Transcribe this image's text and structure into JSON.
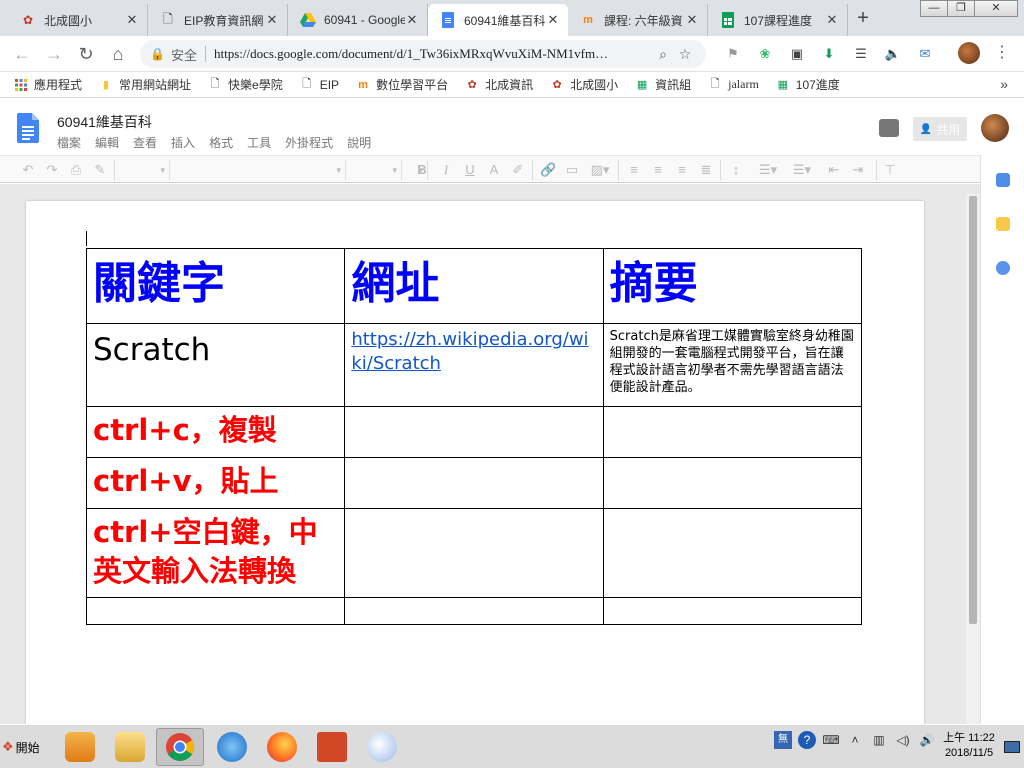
{
  "browser": {
    "tabs": [
      {
        "title": "北成國小",
        "icon": "beicheng-flower-icon",
        "icon_color": "#c0392b"
      },
      {
        "title": "EIP教育資訊網",
        "icon": "page-icon",
        "icon_color": "#666666"
      },
      {
        "title": "60941 - Google",
        "icon": "google-drive-icon",
        "icon_color": "#1fa463"
      },
      {
        "title": "60941維基百科",
        "icon": "google-docs-icon",
        "icon_color": "#4285f4"
      },
      {
        "title": "課程: 六年級資",
        "icon": "moodle-icon",
        "icon_color": "#f98012"
      },
      {
        "title": "107課程進度",
        "icon": "google-sheets-icon",
        "icon_color": "#0f9d58"
      }
    ],
    "active_tab_index": 3,
    "new_tab_label": "+",
    "window_controls": [
      "—",
      "❐",
      "✕"
    ],
    "address": {
      "secure_label": "安全",
      "url": "https://docs.google.com/document/d/1_Tw36ixMRxqWvuXiM-NM1vfm…"
    },
    "bookmarks": [
      {
        "label": "應用程式",
        "icon": "apps-grid-icon"
      },
      {
        "label": "常用網站網址",
        "icon": "folder-icon"
      },
      {
        "label": "快樂e學院",
        "icon": "page-icon"
      },
      {
        "label": "EIP",
        "icon": "page-icon"
      },
      {
        "label": "數位學習平台",
        "icon": "moodle-icon"
      },
      {
        "label": "北成資訊",
        "icon": "beicheng-flower-icon"
      },
      {
        "label": "北成國小",
        "icon": "beicheng-flower-icon"
      },
      {
        "label": "資訊組",
        "icon": "google-sheets-icon"
      },
      {
        "label": "jalarm",
        "icon": "page-icon"
      },
      {
        "label": "107進度",
        "icon": "google-sheets-icon"
      }
    ]
  },
  "docs": {
    "title": "60941維基百科",
    "menu": [
      "檔案",
      "編輯",
      "查看",
      "插入",
      "格式",
      "工具",
      "外掛程式",
      "說明"
    ],
    "share_label": "共用",
    "toolbar_icons": [
      "undo-icon",
      "redo-icon",
      "print-icon",
      "paint-format-icon",
      "zoom-select",
      "style-select",
      "font-select",
      "size-select",
      "bold-icon",
      "italic-icon",
      "underline-icon",
      "text-color-icon",
      "highlight-icon",
      "link-icon",
      "comment-icon",
      "image-icon",
      "align-left-icon",
      "align-center-icon",
      "align-right-icon",
      "justify-icon",
      "line-spacing-icon",
      "numbered-list-icon",
      "bulleted-list-icon",
      "decrease-indent-icon",
      "increase-indent-icon",
      "clear-format-icon"
    ]
  },
  "table": {
    "headers": [
      "關鍵字",
      "網址",
      "摘要"
    ],
    "rows": [
      {
        "keyword": "Scratch",
        "url": "https://zh.wikipedia.org/wiki/Scratch",
        "summary": "Scratch是麻省理工媒體實驗室終身幼稚園組開發的一套電腦程式開發平台，旨在讓程式設計語言初學者不需先學習語言語法便能設計產品。"
      },
      {
        "keyword": "ctrl+c，複製",
        "url": "",
        "summary": ""
      },
      {
        "keyword": "ctrl+v，貼上",
        "url": "",
        "summary": ""
      },
      {
        "keyword": "ctrl+空白鍵，中英文輸入法轉換",
        "url": "",
        "summary": ""
      },
      {
        "keyword": "",
        "url": "",
        "summary": ""
      }
    ],
    "colors": {
      "header": "#0000ff",
      "first_keyword": "#000000",
      "keywords": "#ff0000",
      "link": "#1155cc"
    }
  },
  "taskbar": {
    "start_label": "開始",
    "apps": [
      "media-player-icon",
      "file-explorer-icon",
      "chrome-icon",
      "internet-explorer-icon",
      "firefox-icon",
      "powerpoint-icon",
      "paint-icon"
    ],
    "active_app_index": 2,
    "clock_period_time": "上午 11:22",
    "clock_date": "2018/11/5"
  }
}
